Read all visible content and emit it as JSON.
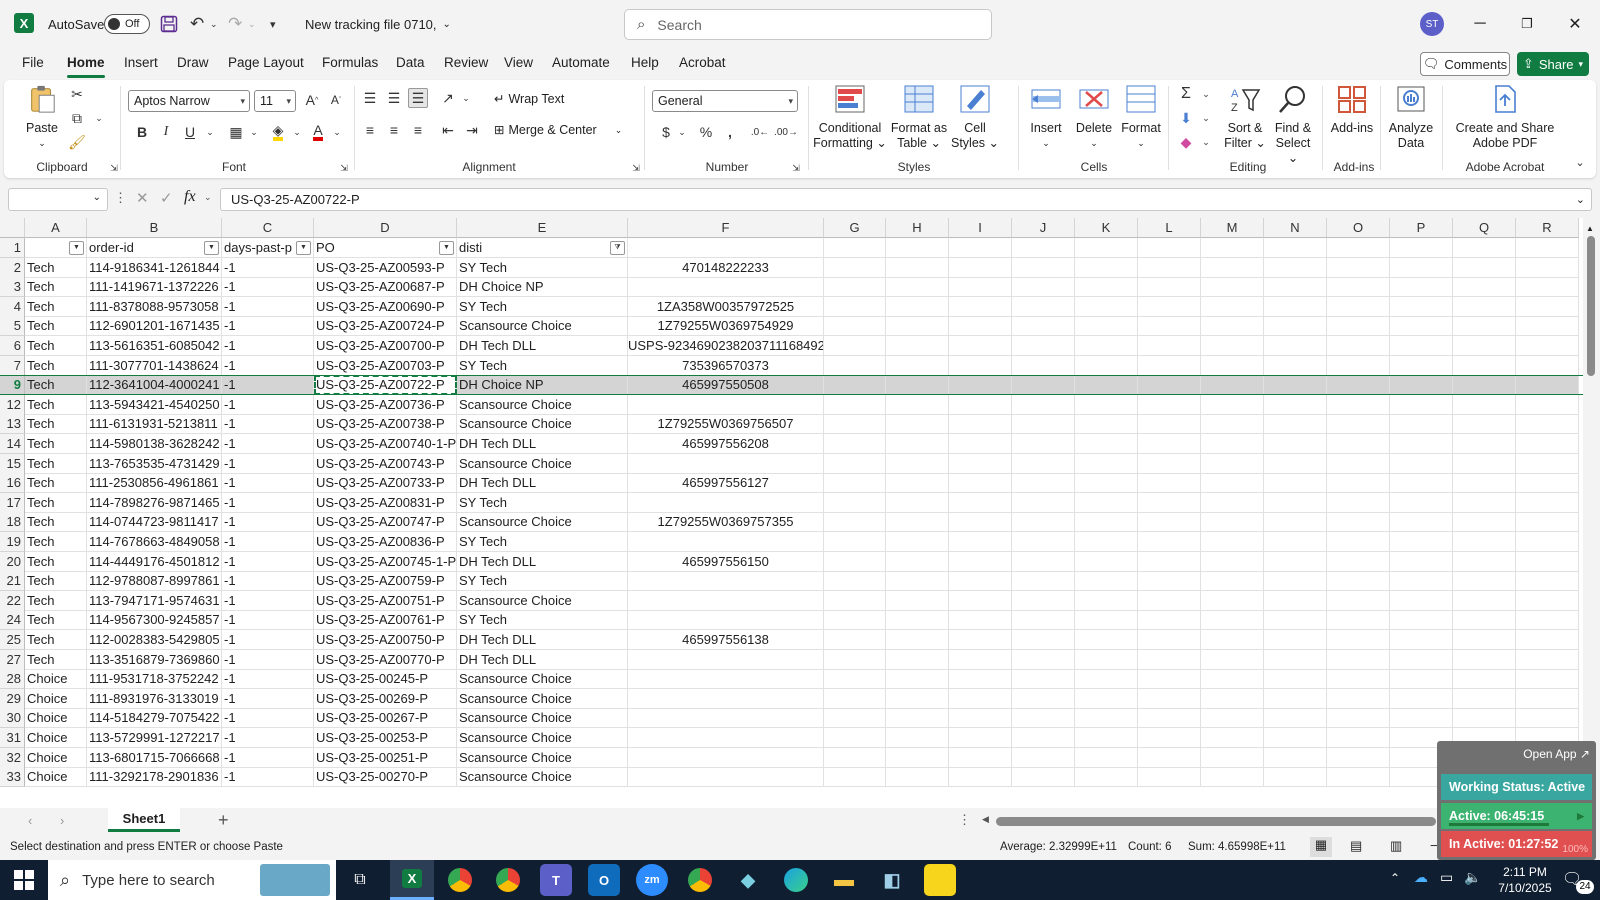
{
  "titlebar": {
    "autosave_label": "AutoSave",
    "autosave_state": "Off",
    "file_name": "New tracking file 0710,",
    "search_placeholder": "Search",
    "user_initials": "ST"
  },
  "menu": [
    "File",
    "Home",
    "Insert",
    "Draw",
    "Page Layout",
    "Formulas",
    "Data",
    "Review",
    "View",
    "Automate",
    "Help",
    "Acrobat"
  ],
  "actions": {
    "comments": "Comments",
    "share": "Share"
  },
  "ribbon": {
    "clipboard": {
      "paste": "Paste",
      "label": "Clipboard"
    },
    "font": {
      "name": "Aptos Narrow",
      "size": "11",
      "label": "Font"
    },
    "alignment": {
      "wrap": "Wrap Text",
      "merge": "Merge & Center",
      "label": "Alignment"
    },
    "number": {
      "format": "General",
      "label": "Number"
    },
    "styles": {
      "cond1": "Conditional",
      "cond2": "Formatting",
      "fmt1": "Format as",
      "fmt2": "Table",
      "cell1": "Cell",
      "cell2": "Styles",
      "label": "Styles"
    },
    "cells": {
      "insert": "Insert",
      "delete": "Delete",
      "format": "Format",
      "label": "Cells"
    },
    "editing": {
      "sort1": "Sort &",
      "sort2": "Filter",
      "find1": "Find &",
      "find2": "Select",
      "label": "Editing"
    },
    "addins": {
      "addins": "Add-ins",
      "analyze1": "Analyze",
      "analyze2": "Data",
      "label": "Add-ins"
    },
    "acrobat": {
      "create1": "Create and Share",
      "create2": "Adobe PDF",
      "label": "Adobe Acrobat"
    }
  },
  "formula_bar": {
    "value": "US-Q3-25-AZ00722-P"
  },
  "columns": [
    "A",
    "B",
    "C",
    "D",
    "E",
    "F",
    "G",
    "H",
    "I",
    "J",
    "K",
    "L",
    "M",
    "N",
    "O",
    "P",
    "Q",
    "R"
  ],
  "header_row": {
    "num": "1",
    "cells": [
      "",
      "order-id",
      "days-past-p",
      "PO",
      "disti",
      ""
    ]
  },
  "rows": [
    {
      "num": "2",
      "cells": [
        "Tech",
        "114-9186341-1261844",
        "-1",
        "US-Q3-25-AZ00593-P",
        "SY Tech",
        "470148222233"
      ]
    },
    {
      "num": "3",
      "cells": [
        "Tech",
        "111-1419671-1372226",
        "-1",
        "US-Q3-25-AZ00687-P",
        "DH Choice NP",
        ""
      ]
    },
    {
      "num": "4",
      "cells": [
        "Tech",
        "111-8378088-9573058",
        "-1",
        "US-Q3-25-AZ00690-P",
        "SY Tech",
        "1ZA358W00357972525"
      ]
    },
    {
      "num": "5",
      "cells": [
        "Tech",
        "112-6901201-1671435",
        "-1",
        "US-Q3-25-AZ00724-P",
        "Scansource Choice",
        "1Z79255W0369754929"
      ]
    },
    {
      "num": "6",
      "cells": [
        "Tech",
        "113-5616351-6085042",
        "-1",
        "US-Q3-25-AZ00700-P",
        "DH Tech DLL",
        "USPS-9234690238203711168492"
      ]
    },
    {
      "num": "7",
      "cells": [
        "Tech",
        "111-3077701-1438624",
        "-1",
        "US-Q3-25-AZ00703-P",
        "SY Tech",
        "735396570373"
      ]
    },
    {
      "num": "9",
      "cells": [
        "Tech",
        "112-3641004-4000241",
        "-1",
        "US-Q3-25-AZ00722-P",
        "DH Choice NP",
        "465997550508"
      ],
      "selected": true
    },
    {
      "num": "12",
      "cells": [
        "Tech",
        "113-5943421-4540250",
        "-1",
        "US-Q3-25-AZ00736-P",
        "Scansource Choice",
        ""
      ]
    },
    {
      "num": "13",
      "cells": [
        "Tech",
        "111-6131931-5213811",
        "-1",
        "US-Q3-25-AZ00738-P",
        "Scansource Choice",
        "1Z79255W0369756507"
      ]
    },
    {
      "num": "14",
      "cells": [
        "Tech",
        "114-5980138-3628242",
        "-1",
        "US-Q3-25-AZ00740-1-P",
        "DH Tech DLL",
        "465997556208"
      ]
    },
    {
      "num": "15",
      "cells": [
        "Tech",
        "113-7653535-4731429",
        "-1",
        "US-Q3-25-AZ00743-P",
        "Scansource Choice",
        ""
      ]
    },
    {
      "num": "16",
      "cells": [
        "Tech",
        "111-2530856-4961861",
        "-1",
        "US-Q3-25-AZ00733-P",
        "DH Tech DLL",
        "465997556127"
      ]
    },
    {
      "num": "17",
      "cells": [
        "Tech",
        "114-7898276-9871465",
        "-1",
        "US-Q3-25-AZ00831-P",
        "SY Tech",
        ""
      ]
    },
    {
      "num": "18",
      "cells": [
        "Tech",
        "114-0744723-9811417",
        "-1",
        "US-Q3-25-AZ00747-P",
        "Scansource Choice",
        "1Z79255W0369757355"
      ]
    },
    {
      "num": "19",
      "cells": [
        "Tech",
        "114-7678663-4849058",
        "-1",
        "US-Q3-25-AZ00836-P",
        "SY Tech",
        ""
      ]
    },
    {
      "num": "20",
      "cells": [
        "Tech",
        "114-4449176-4501812",
        "-1",
        "US-Q3-25-AZ00745-1-P",
        "DH Tech DLL",
        "465997556150"
      ]
    },
    {
      "num": "21",
      "cells": [
        "Tech",
        "112-9788087-8997861",
        "-1",
        "US-Q3-25-AZ00759-P",
        "SY Tech",
        ""
      ]
    },
    {
      "num": "22",
      "cells": [
        "Tech",
        "113-7947171-9574631",
        "-1",
        "US-Q3-25-AZ00751-P",
        "Scansource Choice",
        ""
      ]
    },
    {
      "num": "24",
      "cells": [
        "Tech",
        "114-9567300-9245857",
        "-1",
        "US-Q3-25-AZ00761-P",
        "SY Tech",
        ""
      ]
    },
    {
      "num": "25",
      "cells": [
        "Tech",
        "112-0028383-5429805",
        "-1",
        "US-Q3-25-AZ00750-P",
        "DH Tech DLL",
        "465997556138"
      ]
    },
    {
      "num": "27",
      "cells": [
        "Tech",
        "113-3516879-7369860",
        "-1",
        "US-Q3-25-AZ00770-P",
        "DH Tech DLL",
        ""
      ]
    },
    {
      "num": "28",
      "cells": [
        "Choice",
        "111-9531718-3752242",
        "-1",
        "US-Q3-25-00245-P",
        "Scansource Choice",
        ""
      ]
    },
    {
      "num": "29",
      "cells": [
        "Choice",
        "111-8931976-3133019",
        "-1",
        "US-Q3-25-00269-P",
        "Scansource Choice",
        ""
      ]
    },
    {
      "num": "30",
      "cells": [
        "Choice",
        "114-5184279-7075422",
        "-1",
        "US-Q3-25-00267-P",
        "Scansource Choice",
        ""
      ]
    },
    {
      "num": "31",
      "cells": [
        "Choice",
        "113-5729991-1272217",
        "-1",
        "US-Q3-25-00253-P",
        "Scansource Choice",
        ""
      ]
    },
    {
      "num": "32",
      "cells": [
        "Choice",
        "113-6801715-7066668",
        "-1",
        "US-Q3-25-00251-P",
        "Scansource Choice",
        ""
      ]
    },
    {
      "num": "33",
      "cells": [
        "Choice",
        "111-3292178-2901836",
        "-1",
        "US-Q3-25-00270-P",
        "Scansource Choice",
        ""
      ]
    }
  ],
  "sheet_tab": "Sheet1",
  "status": {
    "message": "Select destination and press ENTER or choose Paste",
    "average": "Average: 2.32999E+11",
    "count": "Count: 6",
    "sum": "Sum: 4.65998E+11",
    "zoom": "100%"
  },
  "widget": {
    "open_app": "Open App ↗",
    "status": "Working Status: Active",
    "active": "Active: 06:45:15",
    "inactive": "In Active: 01:27:52"
  },
  "taskbar": {
    "search_placeholder": "Type here to search",
    "time": "2:11 PM",
    "date": "7/10/2025",
    "notification_count": "24"
  },
  "colors": {
    "excel_green": "#107c41",
    "taskbar": "#0f1e30",
    "widget_green": "#3cb371",
    "widget_red": "#e05050",
    "widget_teal": "#3aa6a0"
  }
}
